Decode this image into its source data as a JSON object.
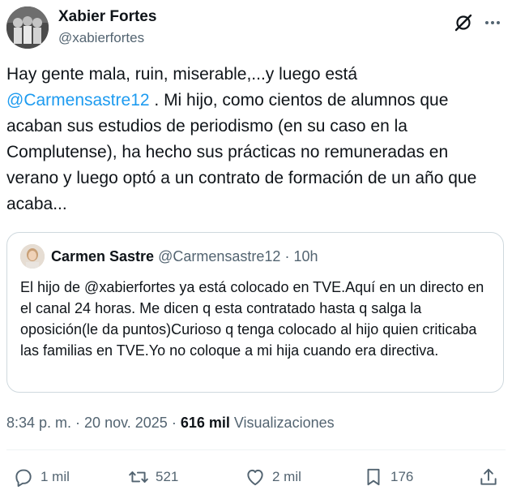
{
  "author": {
    "display_name": "Xabier Fortes",
    "handle": "@xabierfortes"
  },
  "tweet": {
    "text_before": "Hay gente mala, ruin, miserable,...y luego está ",
    "mention": "@Carmensastre12",
    "text_after": " . Mi hijo, como cientos de alumnos que acaban sus estudios de periodismo (en su caso en la Complutense), ha hecho sus prácticas no remuneradas en verano y luego optó a un contrato de formación de un año que acaba..."
  },
  "quote": {
    "display_name": "Carmen Sastre",
    "handle": "@Carmensastre12",
    "separator": "·",
    "time": "10h",
    "text": "El hijo de @xabierfortes ya está colocado en TVE.Aquí en un directo en el canal 24 horas. Me dicen q esta contratado hasta q salga la oposición(le da puntos)Curioso q tenga colocado al hijo quien criticaba las familias en TVE.Yo no coloque a mi hija cuando era directiva."
  },
  "meta": {
    "time": "8:34 p. m.",
    "sep1": " · ",
    "date": "20 nov. 2025",
    "sep2": " · ",
    "views_count": "616 mil",
    "views_label": " Visualizaciones"
  },
  "actions": {
    "replies": "1 mil",
    "reposts": "521",
    "likes": "2 mil",
    "bookmarks": "176"
  },
  "icons": {
    "grok": "grok-icon",
    "more": "more-icon",
    "reply": "reply-icon",
    "repost": "repost-icon",
    "like": "like-icon",
    "bookmark": "bookmark-icon",
    "share": "share-icon"
  }
}
